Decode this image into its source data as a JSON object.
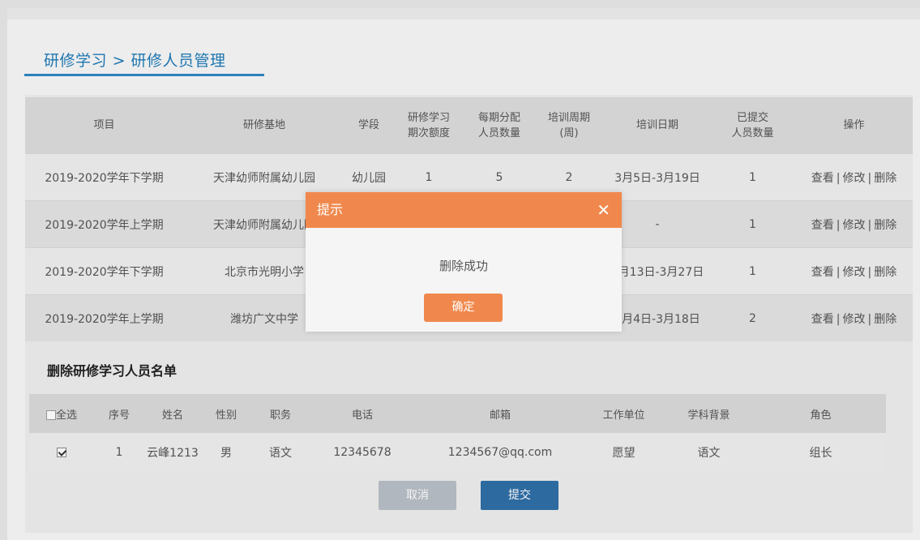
{
  "breadcrumb": {
    "root": "研修学习",
    "sep": ">",
    "current": "研修人员管理"
  },
  "project_table": {
    "headers": [
      [
        "项目"
      ],
      [
        "研修基地"
      ],
      [
        "学段"
      ],
      [
        "研修学习",
        "期次额度"
      ],
      [
        "每期分配",
        "人员数量"
      ],
      [
        "培训周期",
        "(周)"
      ],
      [
        "培训日期"
      ],
      [
        "已提交",
        "人员数量"
      ],
      [
        "操作"
      ]
    ],
    "rows": [
      {
        "project": "2019-2020学年下学期",
        "base": "天津幼师附属幼儿园",
        "stage": "幼儿园",
        "quota": "1",
        "per_period": "5",
        "weeks": "2",
        "dates": "3月5日-3月19日",
        "submitted": "1"
      },
      {
        "project": "2019-2020学年上学期",
        "base": "天津幼师附属幼儿园",
        "stage": "",
        "quota": "",
        "per_period": "",
        "weeks": "",
        "dates": "-",
        "submitted": "1"
      },
      {
        "project": "2019-2020学年下学期",
        "base": "北京市光明小学",
        "stage": "",
        "quota": "",
        "per_period": "",
        "weeks": "",
        "dates": "3月13日-3月27日",
        "submitted": "1"
      },
      {
        "project": "2019-2020学年上学期",
        "base": "潍坊广文中学",
        "stage": "",
        "quota": "",
        "per_period": "",
        "weeks": "",
        "dates": "3月4日-3月18日",
        "submitted": "2"
      }
    ],
    "ops": {
      "view": "查看",
      "edit": "修改",
      "delete": "删除",
      "sep": "|"
    }
  },
  "members": {
    "title": "删除研修学习人员名单",
    "headers": {
      "select_all": "全选",
      "no": "序号",
      "name": "姓名",
      "gender": "性别",
      "duty": "职务",
      "phone": "电话",
      "email": "邮箱",
      "unit": "工作单位",
      "subject": "学科背景",
      "role": "角色"
    },
    "rows": [
      {
        "checked": true,
        "no": "1",
        "name": "云峰1213",
        "gender": "男",
        "duty": "语文",
        "phone": "12345678",
        "email": "1234567@qq.com",
        "unit": "愿望",
        "subject": "语文",
        "role": "组长"
      }
    ],
    "cancel_label": "取消",
    "submit_label": "提交"
  },
  "dialog": {
    "title": "提示",
    "close_glyph": "✕",
    "message": "删除成功",
    "ok_label": "确定",
    "header_color": "#f0884d"
  }
}
